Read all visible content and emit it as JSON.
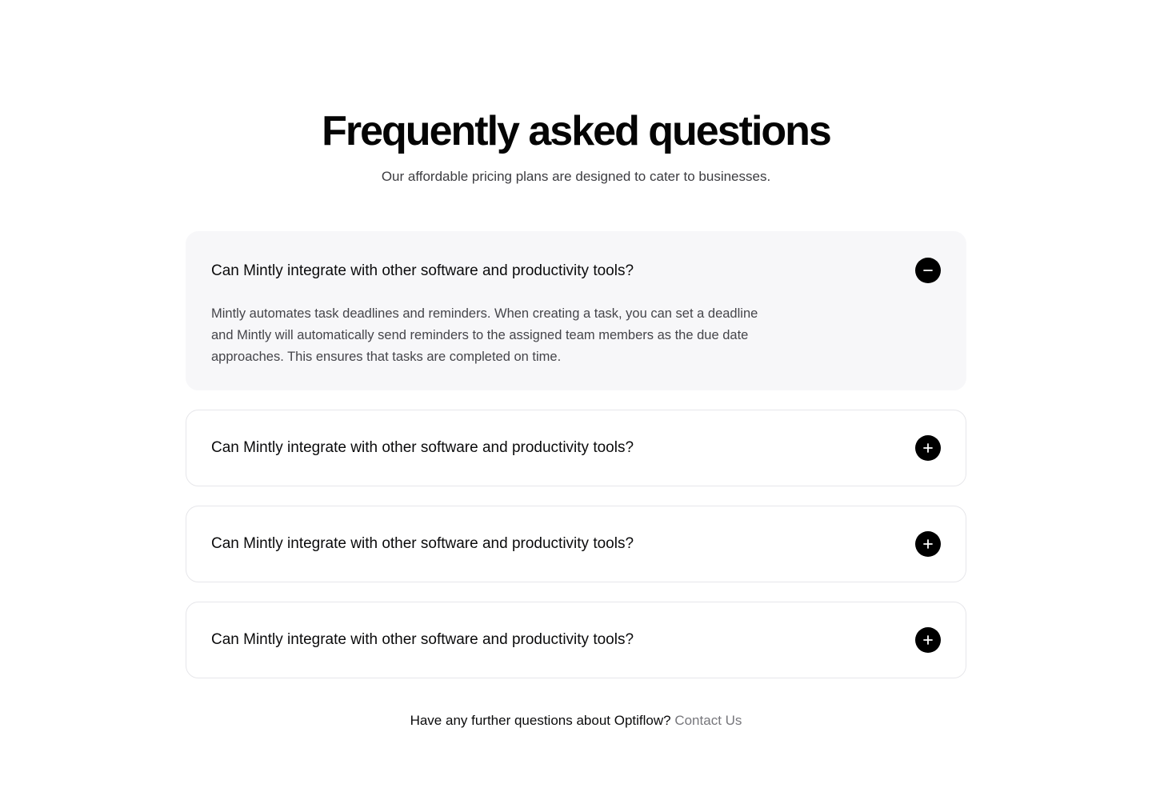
{
  "faq": {
    "title": "Frequently asked questions",
    "subtitle": "Our affordable pricing plans are designed to cater to businesses.",
    "items": [
      {
        "question": "Can Mintly integrate with other software and productivity tools?",
        "answer": "Mintly automates task deadlines and reminders. When creating a task, you can set a deadline and Mintly will automatically send reminders to the assigned team members as the due date approaches. This ensures that tasks are completed on time.",
        "state": "expanded",
        "icon": "minus-icon"
      },
      {
        "question": "Can Mintly integrate with other software and productivity tools?",
        "state": "collapsed",
        "icon": "plus-icon"
      },
      {
        "question": "Can Mintly integrate with other software and productivity tools?",
        "state": "collapsed",
        "icon": "plus-icon"
      },
      {
        "question": "Can Mintly integrate with other software and productivity tools?",
        "state": "collapsed",
        "icon": "plus-icon"
      }
    ],
    "footer": {
      "text": "Have any further questions about Optiflow? ",
      "link_label": "Contact Us"
    }
  },
  "colors": {
    "background": "#ffffff",
    "open_item_background": "#f7f7f9",
    "item_border": "#e6e6ea",
    "toggle_button": "#000000",
    "link": "#77777c"
  }
}
